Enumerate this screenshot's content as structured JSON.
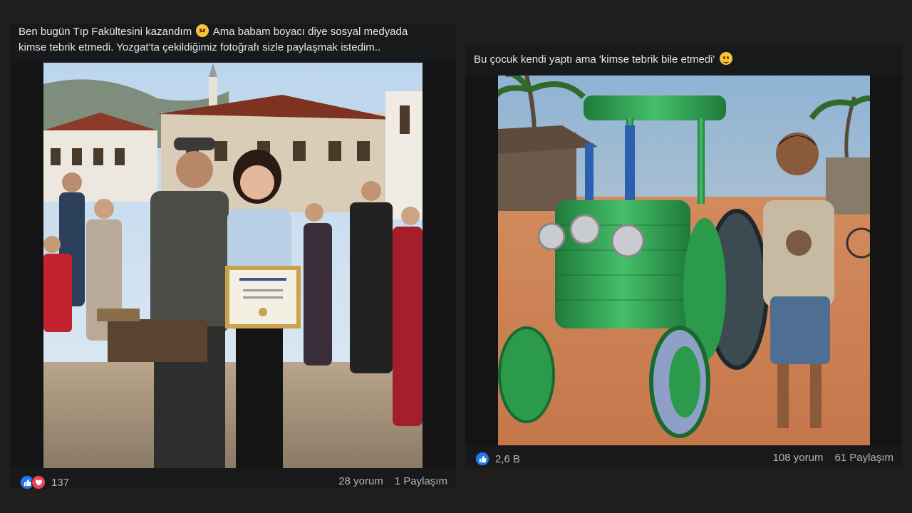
{
  "post1": {
    "caption_line1": "Ben bugün Tıp Fakültesini kazandım",
    "caption_line1_tail": "Ama babam boyacı diye sosyal medyada",
    "caption_line2": "kimse tebrik etmedi. Yozgat'ta çekildiğimiz fotoğrafı sizle paylaşmak istedim..",
    "caption_emoji": "worried-face-emoji",
    "photo_icon": "graduation-photo",
    "reactions": [
      "like-icon",
      "love-icon"
    ],
    "reaction_count": "137",
    "comments": "28 yorum",
    "shares": "1 Paylaşım"
  },
  "post2": {
    "caption": "Bu çocuk kendi yaptı ama 'kimse tebrik bile etmedi'",
    "caption_emoji": "disappointed-face-emoji",
    "photo_icon": "bottle-tractor-photo",
    "reactions": [
      "like-icon"
    ],
    "reaction_count": "2,6 B",
    "comments": "108 yorum",
    "shares": "61 Paylaşım"
  },
  "colors": {
    "like": "#2078f4",
    "love": "#f33e58",
    "post_bg": "#18191a",
    "page_bg": "#201e1c"
  }
}
